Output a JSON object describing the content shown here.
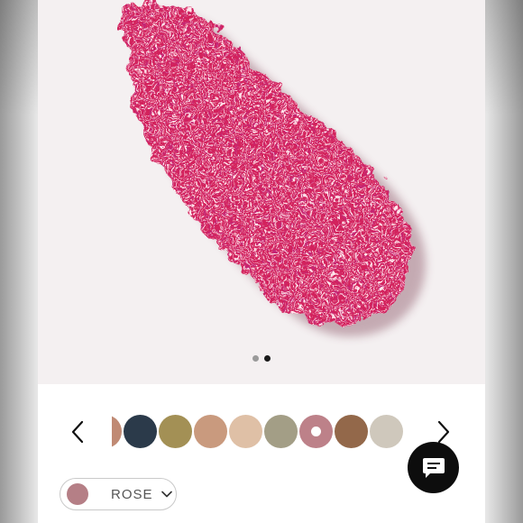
{
  "product": {
    "image_icon": "glitter-swatch-image",
    "swatch_color": "#d4205e",
    "background_color": "#f4f0f1"
  },
  "carousel": {
    "total_slides": 2,
    "active_slide": 2
  },
  "navigation": {
    "prev_icon": "chevron-left-icon",
    "next_icon": "chevron-right-icon"
  },
  "shades": [
    {
      "color": "#c08a74"
    },
    {
      "color": "#2b3a4a"
    },
    {
      "color": "#a39055"
    },
    {
      "color": "#c99a7e"
    },
    {
      "color": "#dfc0a6"
    },
    {
      "color": "#a39e86"
    },
    {
      "color": "#bd8189",
      "selected": true
    },
    {
      "color": "#93684a"
    },
    {
      "color": "#cfc8bc"
    }
  ],
  "shade_selector": {
    "selected_label": "ROSE",
    "selected_color": "#b57f86",
    "chevron_icon": "chevron-down-icon"
  },
  "chat": {
    "icon": "chat-bubble-icon",
    "background": "#0d0d0d"
  }
}
